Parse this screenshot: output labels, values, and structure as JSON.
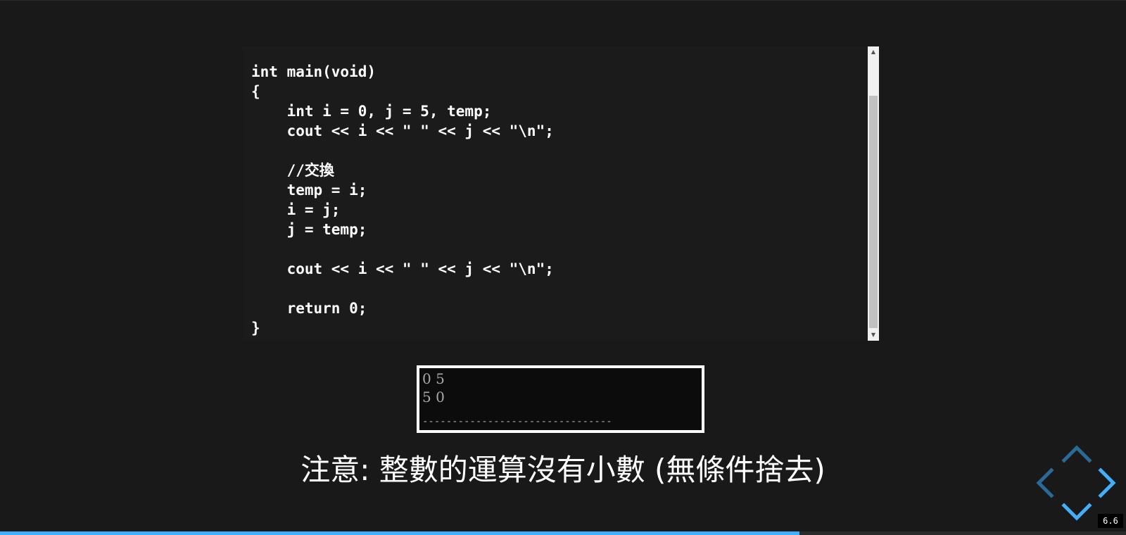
{
  "code": {
    "lines": [
      "int main(void)",
      "{",
      "    int i = 0, j = 5, temp;",
      "    cout << i << \" \" << j << \"\\n\";",
      "",
      "    //交換",
      "    temp = i;",
      "    i = j;",
      "    j = temp;",
      "",
      "    cout << i << \" \" << j << \"\\n\";",
      "",
      "    return 0;",
      "}"
    ]
  },
  "console": {
    "lines": [
      "0 5",
      "5 0"
    ],
    "separator": "--------------------------------"
  },
  "note": "注意: 整數的運算沒有小數 (無條件捨去)",
  "slide_number": "6.6",
  "progress": 0.71,
  "scrollbar": {
    "up_icon": "▲",
    "down_icon": "▼"
  },
  "colors": {
    "background": "#191919",
    "accent": "#42affa",
    "nav_arrow_active": "#42affa",
    "nav_arrow_inactive": "#2a6a96"
  }
}
